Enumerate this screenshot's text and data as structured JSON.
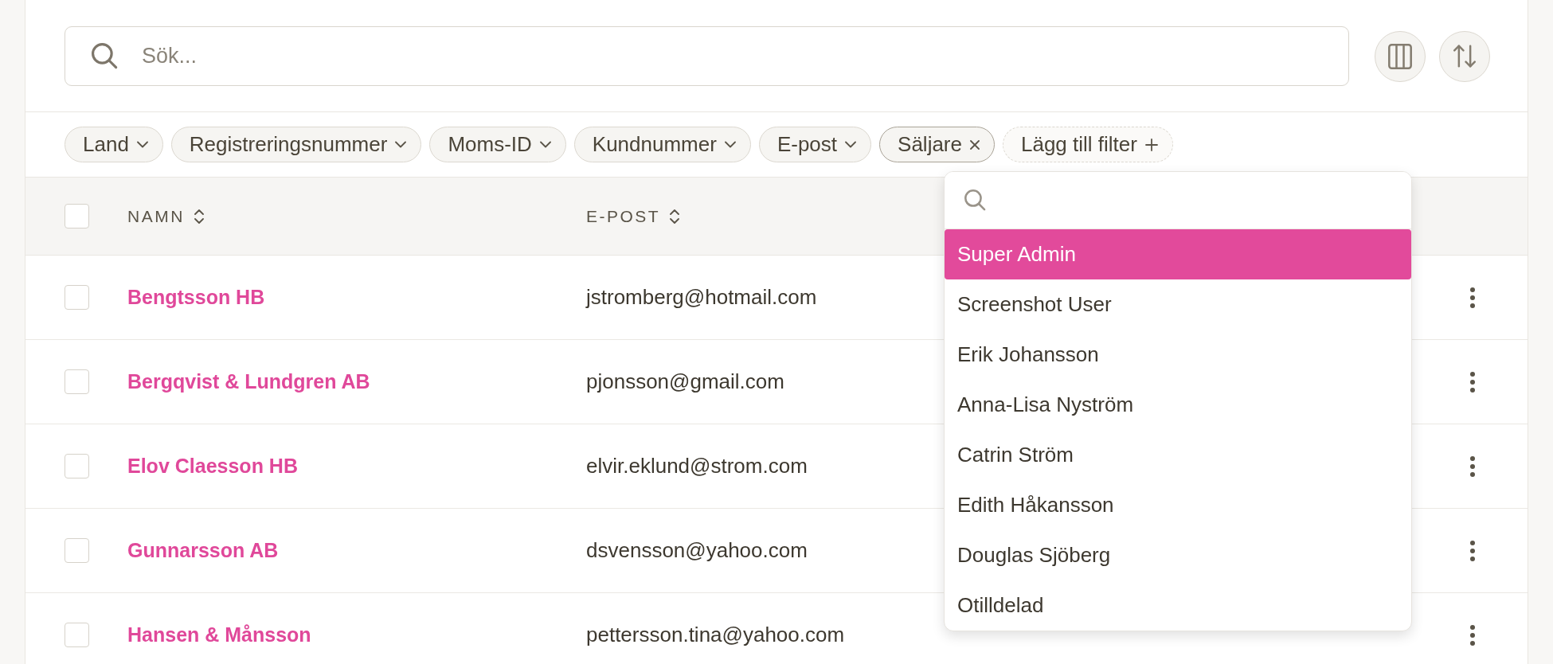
{
  "search": {
    "placeholder": "Sök..."
  },
  "filters": [
    {
      "label": "Land",
      "kind": "dropdown",
      "expanded": false
    },
    {
      "label": "Registreringsnummer",
      "kind": "dropdown",
      "expanded": false
    },
    {
      "label": "Moms-ID",
      "kind": "dropdown",
      "expanded": false
    },
    {
      "label": "Kundnummer",
      "kind": "dropdown",
      "expanded": false
    },
    {
      "label": "E-post",
      "kind": "dropdown",
      "expanded": false
    },
    {
      "label": "Säljare",
      "kind": "applied",
      "expanded": true
    },
    {
      "label": "Lägg till filter",
      "kind": "add",
      "expanded": false
    }
  ],
  "table": {
    "select_all": {
      "checked": false
    },
    "columns": [
      {
        "label": "NAMN",
        "sortable": true
      },
      {
        "label": "E-POST",
        "sortable": true
      }
    ],
    "rows": [
      {
        "name": "Bengtsson HB",
        "email": "jstromberg@hotmail.com",
        "checked": false
      },
      {
        "name": "Bergqvist & Lundgren AB",
        "email": "pjonsson@gmail.com",
        "checked": false
      },
      {
        "name": "Elov Claesson HB",
        "email": "elvir.eklund@strom.com",
        "checked": false
      },
      {
        "name": "Gunnarsson AB",
        "email": "dsvensson@yahoo.com",
        "checked": false
      },
      {
        "name": "Hansen & Månsson",
        "email": "pettersson.tina@yahoo.com",
        "checked": false
      }
    ]
  },
  "dropdown": {
    "options": [
      {
        "label": "Super Admin",
        "selected": true
      },
      {
        "label": "Screenshot User",
        "selected": false
      },
      {
        "label": "Erik Johansson",
        "selected": false
      },
      {
        "label": "Anna-Lisa Nyström",
        "selected": false
      },
      {
        "label": "Catrin Ström",
        "selected": false
      },
      {
        "label": "Edith Håkansson",
        "selected": false
      },
      {
        "label": "Douglas Sjöberg",
        "selected": false
      },
      {
        "label": "Otilldelad",
        "selected": false
      }
    ]
  }
}
